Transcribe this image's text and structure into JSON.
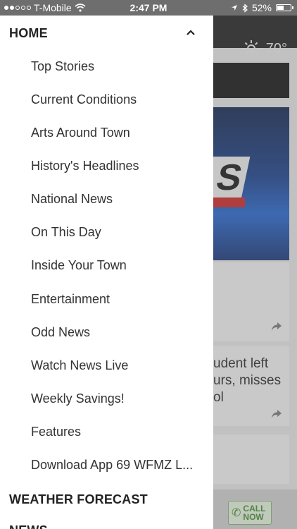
{
  "status_bar": {
    "carrier": "T-Mobile",
    "time": "2:47 PM",
    "battery": "52%",
    "battery_level": 0.52
  },
  "header": {
    "temperature": "70°",
    "weather_icon": "sun-icon"
  },
  "drawer": {
    "section_home": "HOME",
    "items": [
      "Top Stories",
      "Current Conditions",
      "Arts Around Town",
      "History's Headlines",
      "National News",
      "On This Day",
      "Inside Your Town",
      "Entertainment",
      "Odd News",
      "Watch News Live",
      "Weekly Savings!",
      "Features",
      "Download App 69 WFMZ L..."
    ],
    "section_weather": "WEATHER FORECAST",
    "section_next": "NEWS"
  },
  "background": {
    "story_text": "udent left\nurs, misses\nol",
    "call_now": "CALL NOW",
    "logo_fragment": "S"
  },
  "colors": {
    "header_bg": "#1a1a1a",
    "drawer_bg": "#ffffff",
    "call_green": "#3b8a2a"
  }
}
